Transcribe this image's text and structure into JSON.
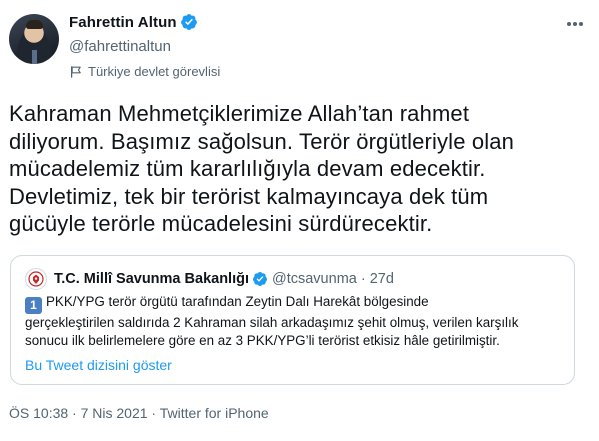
{
  "author": {
    "name": "Fahrettin Altun",
    "handle": "@fahrettinaltun",
    "label": "Türkiye devlet görevlisi",
    "verified": true
  },
  "tweet": {
    "lines": [
      "Kahraman Mehmetçiklerimize Allah’tan rahmet",
      "diliyorum. Başımız sağolsun. Terör örgütleriyle olan",
      "mücadelemiz tüm kararlılığıyla devam edecektir.",
      "Devletimiz, tek bir terörist kalmayıncaya dek tüm",
      "gücüyle terörle mücadelesini sürdürecektir."
    ]
  },
  "quoted_tweet": {
    "name": "T.C. Millî Savunma Bakanlığı",
    "handle": "@tcsavunma",
    "separator": "·",
    "age": "27d",
    "keycap": "1",
    "lines": [
      "PKK/YPG terör örgütü tarafından Zeytin Dalı Harekât bölgesinde",
      "gerçekleştirilen saldırıda 2 Kahraman silah arkadaşımız şehit olmuş, verilen karşılık",
      "sonucu ilk belirlemelere göre en az 3 PKK/YPG’li terörist etkisiz hâle getirilmiştir."
    ],
    "thread_link": "Bu Tweet dizisini göster"
  },
  "footer": {
    "time": "ÖS 10:38",
    "separator": " · ",
    "date": "7 Nis 2021",
    "source": "Twitter for iPhone"
  },
  "colors": {
    "text": "#0f1419",
    "secondary": "#536471",
    "link": "#1d9bf0",
    "border": "#cfd9de",
    "verified": "#1d9bf0"
  },
  "icons": {
    "verified": "verified-badge-icon",
    "label": "government-flag-icon",
    "more": "more-icon"
  }
}
